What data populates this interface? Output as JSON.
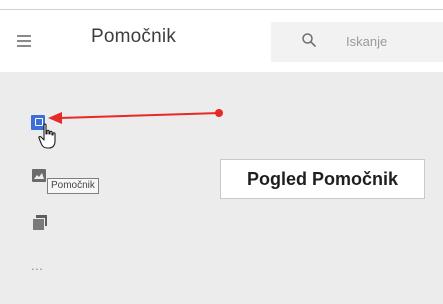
{
  "header": {
    "app_title": "Pomočnik",
    "menu_icon": "hamburger-menu-icon"
  },
  "search": {
    "placeholder": "Iskanje",
    "icon": "search-icon"
  },
  "sidebar": {
    "items": [
      {
        "icon": "assistant-view-icon",
        "state": "hovered"
      },
      {
        "icon": "image-icon"
      },
      {
        "icon": "copy-icon"
      },
      {
        "icon": "more-icon",
        "label": "..."
      }
    ],
    "tooltip": "Pomočnik"
  },
  "annotation": {
    "callout_text": "Pogled Pomočnik",
    "arrow_color": "#e8292a"
  },
  "colors": {
    "content_background": "#ececec",
    "accent_blue": "#3a6fd8",
    "header_background": "#ffffff"
  }
}
